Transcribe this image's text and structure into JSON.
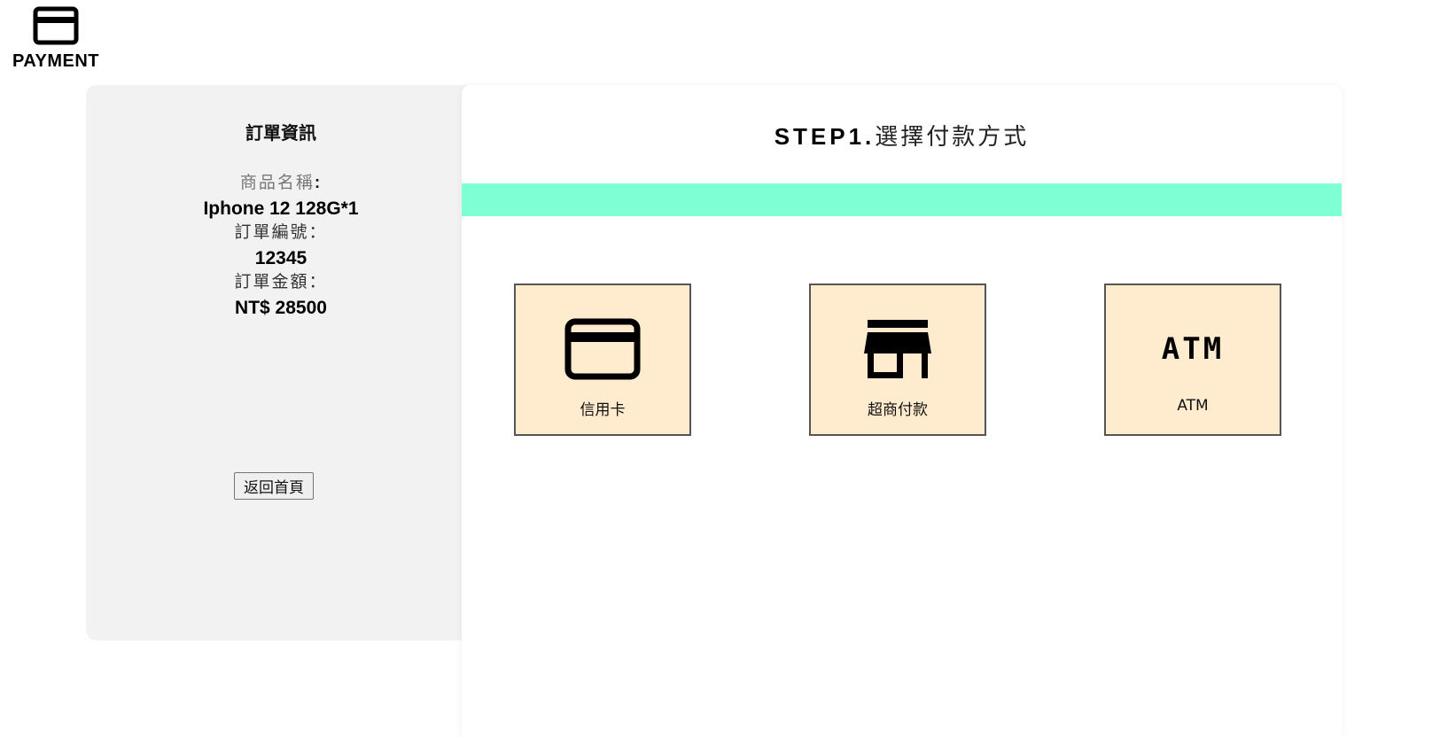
{
  "header": {
    "logo_icon": "credit-card-icon",
    "logo_text": "PAYMENT"
  },
  "order": {
    "title": "訂單資訊",
    "product_label": "商品名稱",
    "product_label_colon": ":",
    "product_value": "Iphone 12 128G*1",
    "order_no_label": "訂單編號：",
    "order_no_value": "12345",
    "amount_label": "訂單金額：",
    "amount_value": "NT$ 28500",
    "home_button": "返回首頁"
  },
  "main": {
    "step_prefix": "STEP1.",
    "step_title": "選擇付款方式",
    "progress_color": "#7fffd4",
    "options": [
      {
        "label": "信用卡",
        "icon": "credit-card-icon"
      },
      {
        "label": "超商付款",
        "icon": "store-icon"
      },
      {
        "label": "ATM",
        "icon": "atm-icon",
        "icon_text": "ATM"
      }
    ]
  },
  "colors": {
    "panel_bg": "#f2f2f2",
    "option_bg": "#ffebcd",
    "progress": "#7fffd4"
  }
}
